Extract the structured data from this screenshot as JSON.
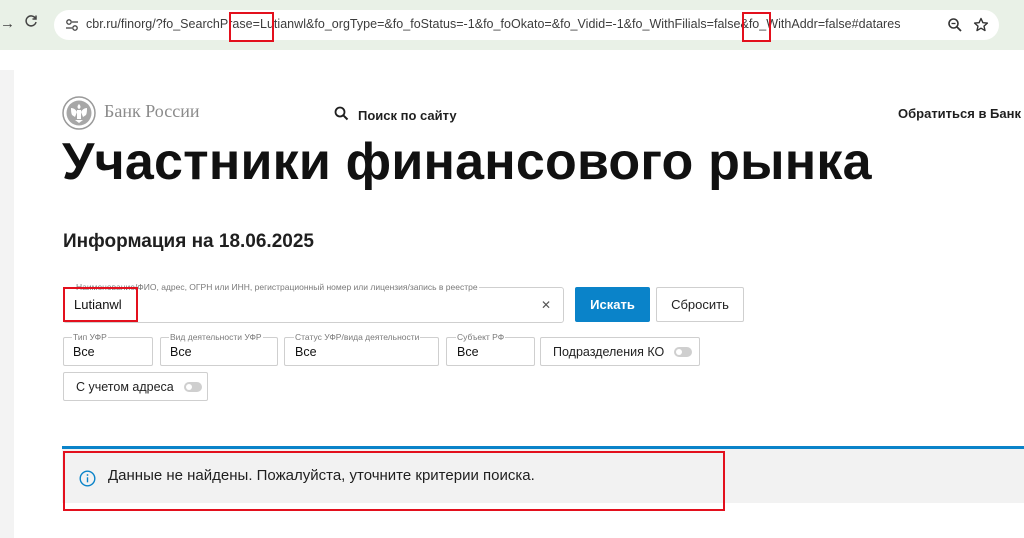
{
  "browser": {
    "url_parts": {
      "p1": "cbr.ru/finorg/?fo_SearchPrase",
      "p2": "=Lutianwl",
      "p3": "&fo_orgType=&fo_foStatus=-1&fo_foOkato=&fo_Vidid=-1&fo_WithFilials=false&fo_WithAddr",
      "p4": "=false",
      "p5": "#datares"
    },
    "icons": [
      "back-arrow-icon",
      "reload-icon",
      "site-info-icon",
      "zoom-icon",
      "star-icon"
    ]
  },
  "header": {
    "logo_text": "Банк России",
    "search_label": "Поиск по сайту",
    "contact_label": "Обратиться в Банк Росс"
  },
  "page": {
    "title": "Участники финансового рынка",
    "info_date": "Информация на 18.06.2025"
  },
  "search": {
    "label": "Наименование/ФИО, адрес, ОГРН или ИНН, регистрационный номер или лицензия/запись в реестре",
    "value": "Lutianwl",
    "submit_label": "Искать",
    "reset_label": "Сбросить"
  },
  "filters": {
    "org_type": {
      "label": "Тип УФР",
      "value": "Все"
    },
    "activity": {
      "label": "Вид деятельности УФР",
      "value": "Все"
    },
    "status": {
      "label": "Статус УФР/вида деятельности",
      "value": "Все"
    },
    "region": {
      "label": "Субъект РФ",
      "value": "Все"
    },
    "subdivisions": {
      "label": "Подразделения КО",
      "enabled": false
    },
    "with_address": {
      "label": "С учетом адреса",
      "enabled": false
    }
  },
  "result": {
    "message": "Данные не найдены. Пожалуйста, уточните критерии поиска."
  },
  "colors": {
    "accent": "#0a83c9",
    "highlight": "#e3101d",
    "chrome_bg": "#e9f1e7"
  }
}
